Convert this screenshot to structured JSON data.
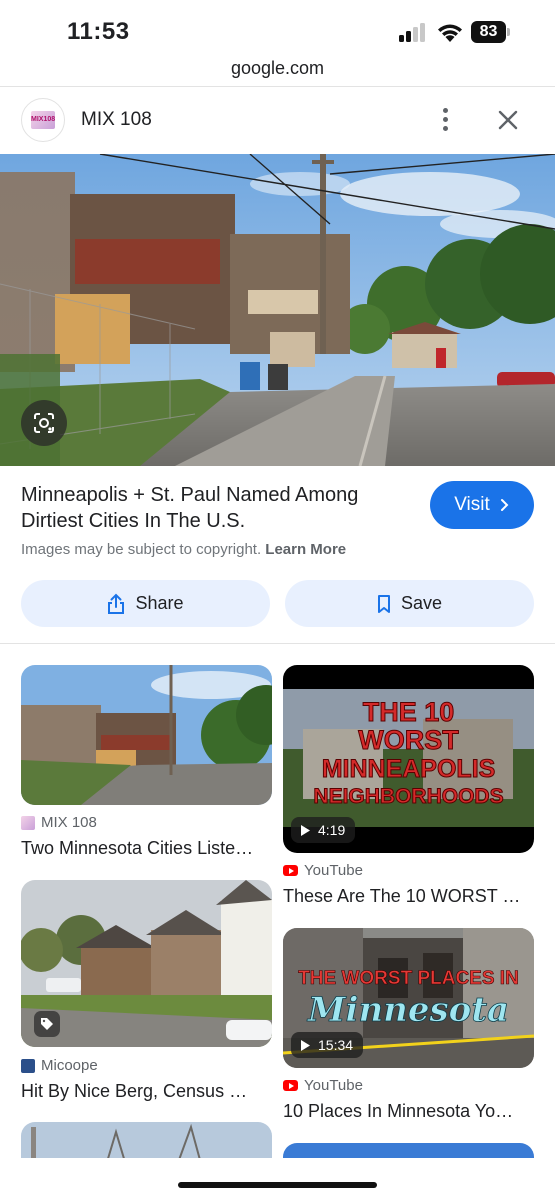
{
  "status_bar": {
    "time": "11:53",
    "battery": "83"
  },
  "browser": {
    "url": "google.com"
  },
  "source_header": {
    "name": "MIX 108",
    "logo_text": "MIX108"
  },
  "result": {
    "title": "Minneapolis + St. Paul Named Among Dirtiest Cities In The U.S.",
    "visit_label": "Visit",
    "copyright_text": "Images may be subject to copyright.",
    "learn_more_label": "Learn More",
    "share_label": "Share",
    "save_label": "Save"
  },
  "related": [
    {
      "source": "MIX 108",
      "title": "Two Minnesota Cities Liste…"
    },
    {
      "source": "YouTube",
      "title": "These Are The 10 WORST …",
      "duration": "4:19",
      "overlay_line1": "THE 10",
      "overlay_line2": "WORST",
      "overlay_line3": "MINNEAPOLIS",
      "overlay_line4": "NEIGHBORHOODS"
    },
    {
      "source": "Micoope",
      "title": "Hit By Nice Berg, Census …"
    },
    {
      "source": "YouTube",
      "title": "10 Places In Minnesota Yo…",
      "duration": "15:34",
      "overlay_line1": "THE WORST PLACES IN",
      "overlay_line2": "Minnesota"
    }
  ],
  "colors": {
    "accent": "#1a73e8",
    "pill_bg": "#e8f0fe",
    "youtube_red": "#ff0000"
  },
  "icons": [
    "wifi-icon",
    "cellular-signal-icon",
    "battery-icon",
    "more-vert-icon",
    "close-icon",
    "google-lens-icon",
    "chevron-right-icon",
    "share-icon",
    "bookmark-icon",
    "play-icon",
    "tag-icon"
  ]
}
